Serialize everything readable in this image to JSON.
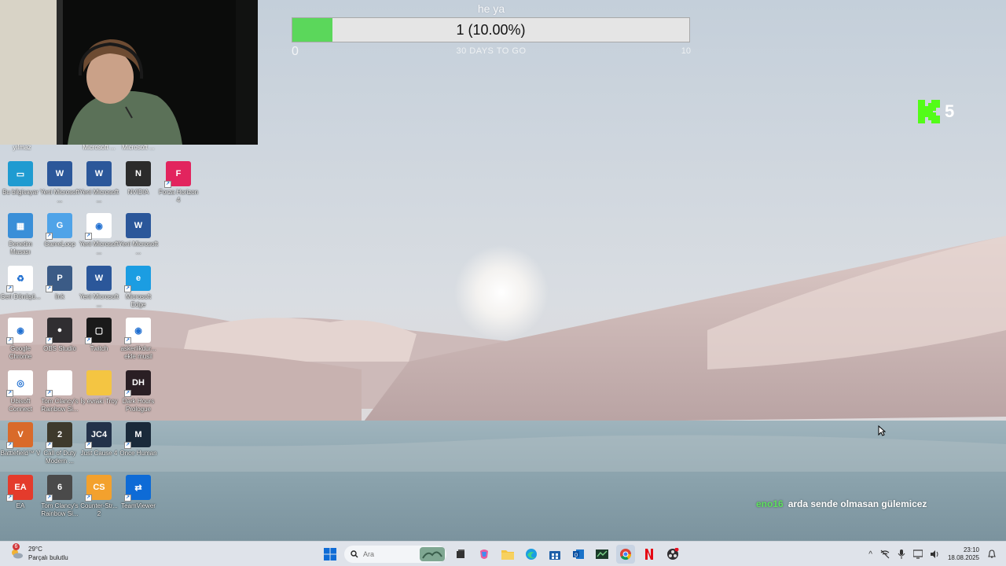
{
  "goal": {
    "title": "he ya",
    "value_text": "1 (10.00%)",
    "progress_percent": 10,
    "min": "0",
    "max": "10",
    "subtitle": "30 DAYS TO GO",
    "fill_color": "#5bd75b"
  },
  "kick": {
    "count": "5",
    "color": "#53fc18"
  },
  "chat": {
    "user": "eno16",
    "message": "arda sende olmasan gülemicez"
  },
  "desktop": {
    "partial_labels": [
      "yılmaz",
      "Microsoft ...",
      "Microsoft ..."
    ],
    "icons": [
      {
        "label": "Bu bilgisayar",
        "icon": "computer-icon"
      },
      {
        "label": "Yeni Microsoft ...",
        "icon": "word-icon"
      },
      {
        "label": "Yeni Microsoft ...",
        "icon": "word-icon"
      },
      {
        "label": "NVIDIA",
        "icon": "nvidia-icon"
      },
      {
        "label": "Forza Horizon 4",
        "icon": "forza-icon"
      },
      {
        "label": "Denetim Masası",
        "icon": "control-panel-icon"
      },
      {
        "label": "GameLoop",
        "icon": "gameloop-icon"
      },
      {
        "label": "Yeni Microsoft ...",
        "icon": "chrome-shortcut-icon"
      },
      {
        "label": "Yeni Microsoft ...",
        "icon": "word-icon"
      },
      {
        "label": "Geri Dönüşü...",
        "icon": "recycle-bin-icon"
      },
      {
        "label": "link",
        "icon": "pubg-icon"
      },
      {
        "label": "Yeni Microsoft ...",
        "icon": "word-icon"
      },
      {
        "label": "Microsoft Edge",
        "icon": "edge-icon"
      },
      {
        "label": "Google Chrome",
        "icon": "chrome-icon"
      },
      {
        "label": "OBS Studio",
        "icon": "obs-icon"
      },
      {
        "label": "Twitch",
        "icon": "twitch-icon"
      },
      {
        "label": "askerlikdur... ekle musil",
        "icon": "chrome-shortcut-icon"
      },
      {
        "label": "Ubisoft Connect",
        "icon": "ubisoft-icon"
      },
      {
        "label": "Tom Clancy's Rainbow Si...",
        "icon": "file-icon"
      },
      {
        "label": "İş evraki Troy",
        "icon": "folder-icon"
      },
      {
        "label": "Dark Hours Prologue",
        "icon": "dark-hours-icon"
      },
      {
        "label": "Battlefield™ V",
        "icon": "battlefield-icon"
      },
      {
        "label": "Call of Duty Modern ...",
        "icon": "cod-icon"
      },
      {
        "label": "Just Cause 4",
        "icon": "just-cause-icon"
      },
      {
        "label": "Once Human",
        "icon": "once-human-icon"
      },
      {
        "label": "EA",
        "icon": "ea-icon"
      },
      {
        "label": "Tom Clancy's Rainbow Si...",
        "icon": "rainbow-six-icon"
      },
      {
        "label": "Counter-Str... 2",
        "icon": "counter-strike-icon"
      },
      {
        "label": "TeamViewer",
        "icon": "teamviewer-icon"
      }
    ]
  },
  "taskbar": {
    "weather_temp": "29°C",
    "weather_desc": "Parçalı bulutlu",
    "weather_badge": "6",
    "search_placeholder": "Ara",
    "time": "23:10",
    "date": "18.08.2025"
  }
}
